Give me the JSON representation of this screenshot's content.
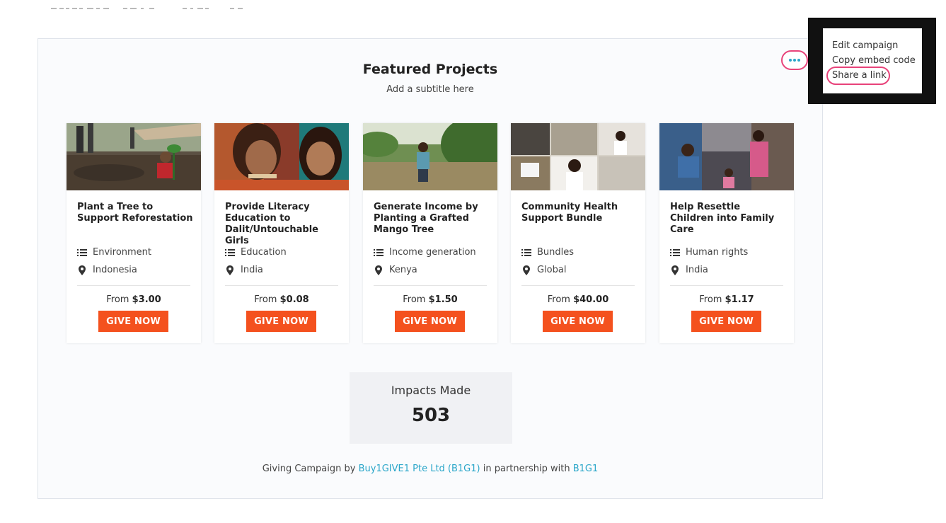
{
  "widget": {
    "title": "Featured Projects",
    "subtitle": "Add a subtitle here",
    "more_icon": "ellipsis-icon"
  },
  "projects": [
    {
      "title": "Plant a Tree to Support Reforestation",
      "category": "Environment",
      "location": "Indonesia",
      "price_prefix": "From",
      "price": "$3.00",
      "cta": "GIVE NOW"
    },
    {
      "title": "Provide Literacy Education to Dalit/Untouchable Girls",
      "category": "Education",
      "location": "India",
      "price_prefix": "From",
      "price": "$0.08",
      "cta": "GIVE NOW"
    },
    {
      "title": "Generate Income by Planting a Grafted Mango Tree",
      "category": "Income generation",
      "location": "Kenya",
      "price_prefix": "From",
      "price": "$1.50",
      "cta": "GIVE NOW"
    },
    {
      "title": "Community Health Support Bundle",
      "category": "Bundles",
      "location": "Global",
      "price_prefix": "From",
      "price": "$40.00",
      "cta": "GIVE NOW"
    },
    {
      "title": "Help Resettle Children into Family Care",
      "category": "Human rights",
      "location": "India",
      "price_prefix": "From",
      "price": "$1.17",
      "cta": "GIVE NOW"
    }
  ],
  "impact": {
    "label": "Impacts Made",
    "value": "503"
  },
  "footer": {
    "prefix": "Giving Campaign by ",
    "org": "Buy1GIVE1 Pte Ltd (B1G1)",
    "middle": " in partnership with ",
    "partner": "B1G1"
  },
  "menu": {
    "items": [
      "Edit campaign",
      "Copy embed code",
      "Share a link"
    ]
  },
  "colors": {
    "accent_orange": "#f4511e",
    "link_teal": "#2aa6c9",
    "highlight_pink": "#e8437a"
  }
}
